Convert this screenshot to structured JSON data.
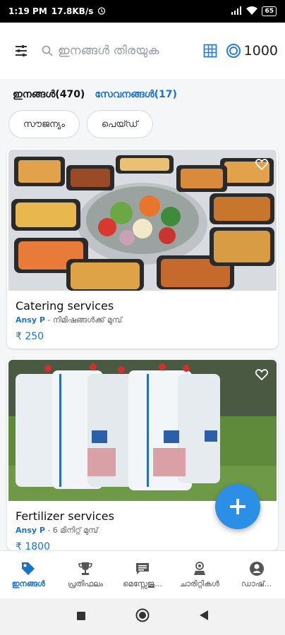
{
  "status_bar": {
    "time": "1:19 PM",
    "speed": "17.8KB/s",
    "battery": "65"
  },
  "header": {
    "search_placeholder": "ഇനങ്ങൾ തിരയുക",
    "coins": "1000",
    "icons": [
      "filter-icon",
      "search-icon",
      "grid-view-icon",
      "coin-icon"
    ]
  },
  "tabs": {
    "items_label": "ഇനങ്ങൾ(470)",
    "services_label": "സേവനങ്ങൾ(17)"
  },
  "filters": {
    "free": "സൗജന്യം",
    "paid": "പെയ്ഡ്"
  },
  "listings": [
    {
      "title": "Catering services",
      "user": "Ansy P",
      "time": " - നിമിഷങ്ങൾക്ക് മുമ്പ്",
      "price": "₹ 250"
    },
    {
      "title": "Fertilizer services",
      "user": "Ansy P",
      "time": " - 6 മിനിറ്റ് മുമ്പ്",
      "price": "₹ 1800"
    }
  ],
  "bottom_nav": {
    "items": "ഇനങ്ങൾ",
    "rewards": "പ്രതിഫലം",
    "messages": "മെസ്സേജു...",
    "charities": "ചാരിറ്റികൾ",
    "dashboard": "ഡാഷ്..."
  },
  "colors": {
    "accent": "#1a73c8",
    "fab": "#2b8fe6"
  }
}
